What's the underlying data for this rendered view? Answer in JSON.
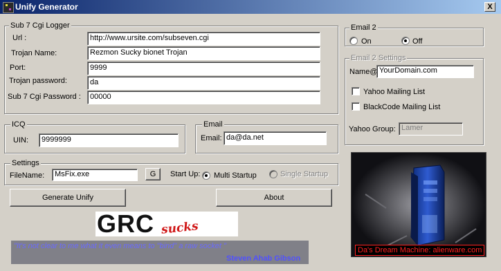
{
  "window": {
    "title": "Unify Generator",
    "close_glyph": "X"
  },
  "sub7": {
    "legend": "Sub 7 Cgi Logger",
    "url_label": "Url :",
    "url_value": "http://www.ursite.com/subseven.cgi",
    "trojan_name_label": "Trojan Name:",
    "trojan_name_value": "Rezmon Sucky bionet Trojan",
    "port_label": "Port:",
    "port_value": "9999",
    "trojan_password_label": "Trojan password:",
    "trojan_password_value": "da",
    "cgi_password_label": "Sub 7 Cgi Password :",
    "cgi_password_value": "00000"
  },
  "icq": {
    "legend": "ICQ",
    "uin_label": "UIN:",
    "uin_value": "9999999"
  },
  "email": {
    "legend": "Email",
    "email_label": "Email:",
    "email_value": "da@da.net"
  },
  "settings": {
    "legend": "Settings",
    "filename_label": "FileName:",
    "filename_value": "MsFix.exe",
    "g_button": "G",
    "startup_label": "Start Up:",
    "multi_startup": "Multi Startup",
    "single_startup": "Single Startup",
    "selected": "Multi Startup"
  },
  "buttons": {
    "generate": "Generate Unify",
    "about": "About"
  },
  "email2": {
    "legend": "Email 2",
    "on": "On",
    "off": "Off",
    "selected": "Off"
  },
  "email2_settings": {
    "legend": "Email 2 Settings",
    "name_label": "Name@",
    "name_value": "YourDomain.com",
    "yahoo_list": "Yahoo Mailing List",
    "yahoo_checked": false,
    "blackcode_list": "BlackCode Mailing List",
    "blackcode_checked": false,
    "yahoo_group_label": "Yahoo Group:",
    "yahoo_group_value": "Lamer"
  },
  "logo": {
    "main": "GRC",
    "sub": "sucks"
  },
  "quote": {
    "text": "\"It's not clear to me what it even means to \"bind\" a raw socket \"",
    "author": "Steven Ahab Gibson"
  },
  "ad": {
    "caption": "Da's Dream Machine: alienware.com"
  },
  "colors": {
    "title_start": "#0a246a",
    "title_end": "#a6caf0",
    "face": "#d4d0c8",
    "logo_red": "#d01818",
    "quote_blue": "#6a6aff",
    "ad_red": "#ff2020"
  },
  "icons": [
    "app-icon",
    "close-icon",
    "alienware-tower-icon"
  ]
}
